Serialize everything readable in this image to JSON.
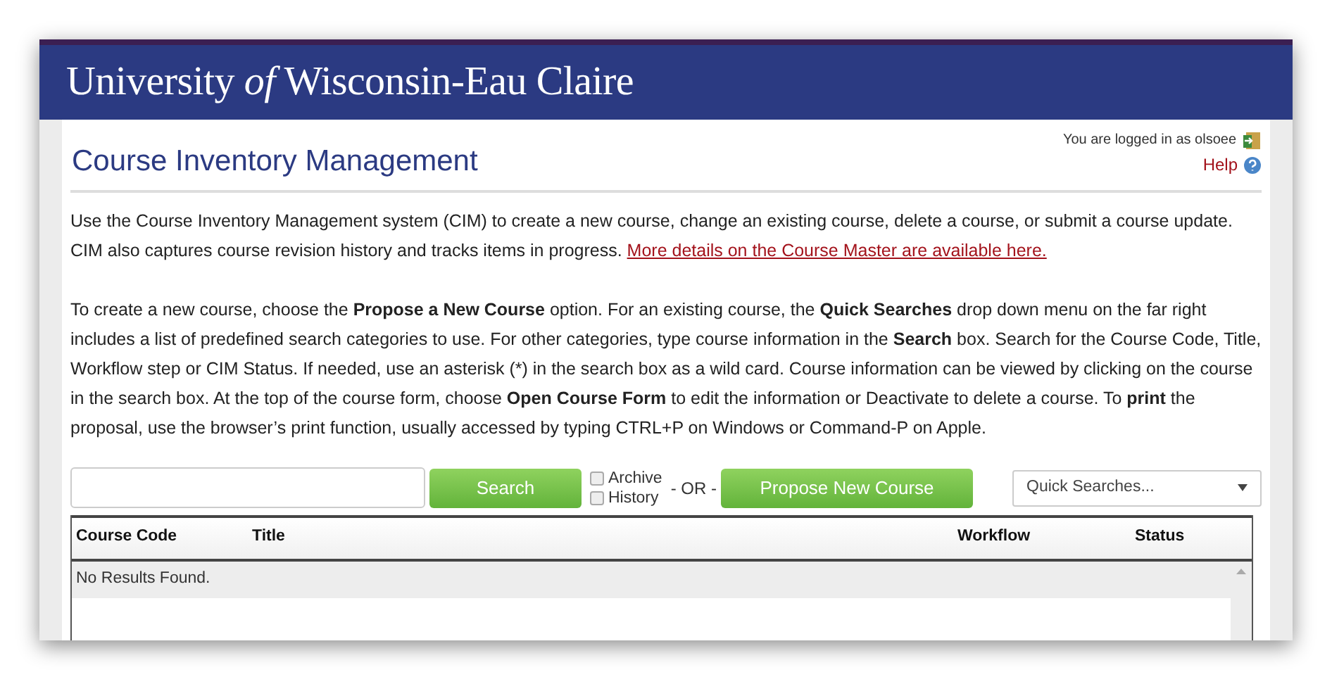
{
  "header": {
    "logo": "University *of* Wisconsin-Eau Claire"
  },
  "page": {
    "title": "Course Inventory Management",
    "login_text": "You are logged in as olsoee",
    "help_link": "Help"
  },
  "intro": {
    "text": "Use the Course Inventory Management system (CIM) to create a new course, change an existing course, delete a course, or submit a course update. CIM also captures course revision history and tracks items in progress.",
    "link": "More details on the Course Master are available here."
  },
  "instructions": "To create a new course, choose the **Propose a New Course** option. For an existing course, the **Quick Searches** drop down menu on the far right includes a list of predefined search categories to use. For other categories, type course information in the **Search** box. Search for the Course Code, Title, Workflow step or CIM Status. If needed, use an asterisk (*) in the search box as a wild card. Course information can be viewed by clicking on the course in the search box. At the top of the course form, choose **Open Course Form** to edit the information or Deactivate to delete a course. To **print** the proposal, use the browser’s print function, usually accessed by typing CTRL+P on Windows or Command-P on Apple.",
  "search": {
    "button": "Search",
    "options": [
      {
        "label": "Archive",
        "checked": false
      },
      {
        "label": "History",
        "checked": false
      }
    ],
    "separator": "- OR -",
    "propose_button": "Propose New Course",
    "quick_searches": "Quick Searches..."
  },
  "table": {
    "columns": [
      "Course Code",
      "Title",
      "Workflow",
      "Status"
    ],
    "empty_message": "No Results Found."
  }
}
